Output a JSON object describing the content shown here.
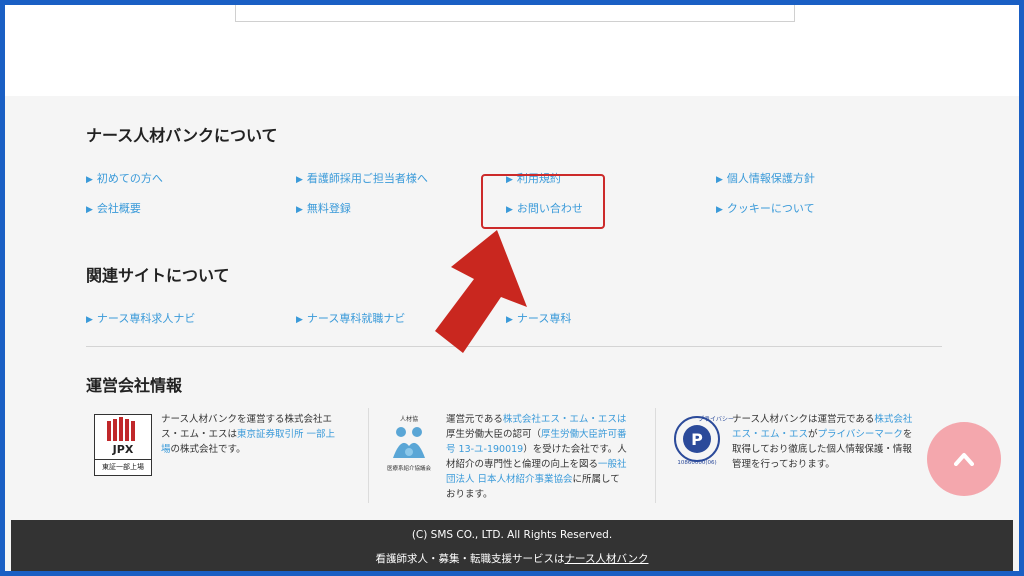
{
  "about": {
    "title": "ナース人材バンクについて",
    "links": [
      "初めての方へ",
      "看護師採用ご担当者様へ",
      "利用規約",
      "個人情報保護方針",
      "会社概要",
      "無料登録",
      "お問い合わせ",
      "クッキーについて"
    ]
  },
  "related": {
    "title": "関連サイトについて",
    "links": [
      "ナース専科求人ナビ",
      "ナース専科就職ナビ",
      "ナース専科"
    ]
  },
  "company": {
    "title": "運営会社情報",
    "col1": {
      "t1": "ナース人材バンクを運営する株式会社エ",
      "t2": "ス・エム・エスは",
      "a1": "東京証券取引所 一部上",
      "a2": "場",
      "t3": "の株式会社です。",
      "logo_text": "JPX",
      "logo_sub": "東証一部上場"
    },
    "col2": {
      "t1": "運営元である",
      "a1": "株式会社エス・エム・エスは",
      "t2": "厚生労働大臣の認可（",
      "a2": "厚生労働大臣許可番",
      "a3": "号 13-ユ-190019",
      "t3": "）を受けた会社です。人",
      "t4": "材紹介の専門性と倫理の向上を図る",
      "a4": "一般社",
      "a5": "団法人 日本人材紹介事業協会",
      "t5": "に所属して",
      "t6": "おります。",
      "logo_top": "人材協",
      "logo_bottom": "医療系紹介協議会"
    },
    "col3": {
      "t1": "ナース人材バンクは運営元である",
      "a1": "株式会社",
      "a2": "エス・エム・エス",
      "t2": "が",
      "a3": "プライバシーマーク",
      "t3": "を",
      "t4": "取得しており徹底した個人情報保護・情報",
      "t5": "管理を行っております。",
      "logo_text": "プライバシー",
      "logo_num": "10860000(06)"
    }
  },
  "footer": {
    "copyright": "(C) SMS CO., LTD. All Rights Reserved.",
    "tagline_prefix": "看護師求人・募集・転職支援サービスは",
    "tagline_link": "ナース人材バンク"
  },
  "colors": {
    "link": "#3a9ad9",
    "annotation": "#cc2a2a",
    "scroll_button": "#f4a7ad",
    "frame_border": "#1a5fc4"
  }
}
